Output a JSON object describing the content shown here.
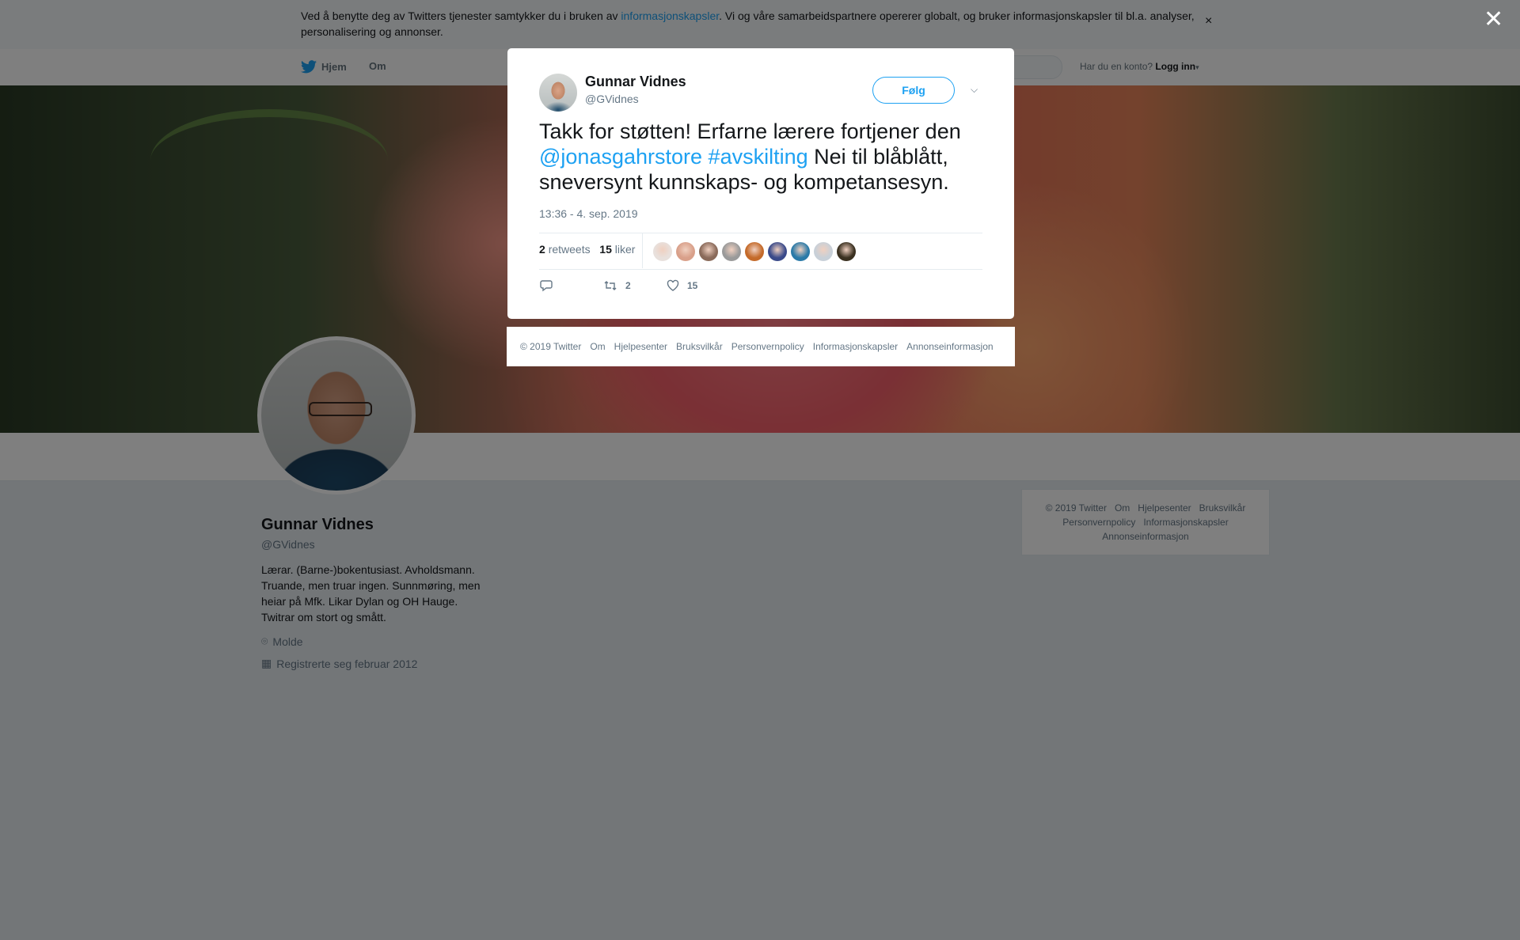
{
  "cookie": {
    "text_before": "Ved å benytte deg av Twitters tjenester samtykker du i bruken av ",
    "link": "informasjonskapsler",
    "text_after": ". Vi og våre samarbeidspartnere opererer globalt, og bruker informasjonskapsler til bl.a. analyser, personalisering og annonser.",
    "close": "×"
  },
  "nav": {
    "home": "Hjem",
    "about": "Om",
    "account_prompt": "Har du en konto?",
    "login": "Logg inn"
  },
  "profile": {
    "name": "Gunnar Vidnes",
    "handle": "@GVidnes",
    "bio": "Lærar. (Barne-)bokentusiast. Avholdsmann. Truande, men truar ingen. Sunnmøring, men heiar på Mfk. Likar Dylan og OH Hauge. Twitrar om stort og smått.",
    "location": "Molde",
    "joined": "Registrerte seg februar 2012"
  },
  "right_footer": [
    "© 2019 Twitter",
    "Om",
    "Hjelpesenter",
    "Bruksvilkår",
    "Personvernpolicy",
    "Informasjonskapsler",
    "Annonseinformasjon"
  ],
  "overlay_close": "✕",
  "tweet": {
    "name": "Gunnar Vidnes",
    "handle": "@GVidnes",
    "follow": "Følg",
    "text_start": "Takk for støtten! Erfarne lærere fortjener den ",
    "mention": "@jonasgahrstore",
    "hashtag": "#avskilting",
    "text_end": " Nei til blåblått, sneversynt kunnskaps- og kompetansesyn.",
    "date": "13:36 - 4. sep. 2019",
    "retweets_count": "2",
    "retweets_label": "retweets",
    "likes_count": "15",
    "likes_label": "liker",
    "action_retweets": "2",
    "action_likes": "15",
    "liker_colors": [
      "#e8e0dc",
      "#d9a08a",
      "#8a6a5a",
      "#9a9a9a",
      "#c46a2a",
      "#3a4a8a",
      "#2a7aa8",
      "#c8d0d8",
      "#3a3020"
    ]
  },
  "modal_footer": [
    "© 2019 Twitter",
    "Om",
    "Hjelpesenter",
    "Bruksvilkår",
    "Personvernpolicy",
    "Informasjonskapsler",
    "Annonseinformasjon"
  ],
  "colors": {
    "accent": "#1da1f2",
    "text": "#14171a",
    "muted": "#657786"
  }
}
